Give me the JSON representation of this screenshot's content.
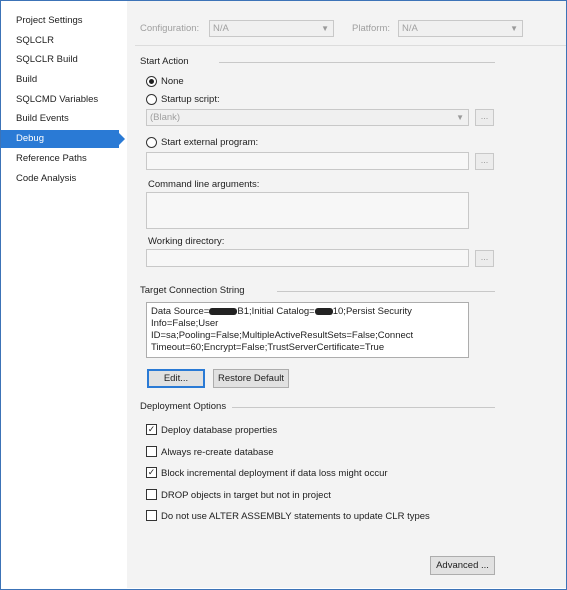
{
  "sidebar": {
    "items": [
      {
        "label": "Project Settings"
      },
      {
        "label": "SQLCLR"
      },
      {
        "label": "SQLCLR Build"
      },
      {
        "label": "Build"
      },
      {
        "label": "SQLCMD Variables"
      },
      {
        "label": "Build Events"
      },
      {
        "label": "Debug",
        "selected": true
      },
      {
        "label": "Reference Paths"
      },
      {
        "label": "Code Analysis"
      }
    ]
  },
  "config_bar": {
    "configuration_label": "Configuration:",
    "configuration_value": "N/A",
    "platform_label": "Platform:",
    "platform_value": "N/A"
  },
  "start_action": {
    "title": "Start Action",
    "none_label": "None",
    "startup_script_label": "Startup script:",
    "startup_script_value": "(Blank)",
    "external_program_label": "Start external program:",
    "browse_label": "...",
    "command_line_label": "Command line arguments:",
    "working_dir_label": "Working directory:"
  },
  "target_connection": {
    "title": "Target Connection String",
    "text_part1": "Data Source=",
    "text_part2": "B1;Initial Catalog=",
    "text_part3": "10;Persist Security Info=False;User ID=sa;Pooling=False;MultipleActiveResultSets=False;Connect Timeout=60;Encrypt=False;TrustServerCertificate=True",
    "edit_button": "Edit...",
    "restore_button": "Restore Default"
  },
  "deployment": {
    "title": "Deployment Options",
    "options": [
      {
        "label": "Deploy database properties",
        "checked": true
      },
      {
        "label": "Always re-create database",
        "checked": false
      },
      {
        "label": "Block incremental deployment if data loss might occur",
        "checked": true
      },
      {
        "label": "DROP objects in target but not in project",
        "checked": false
      },
      {
        "label": "Do not use ALTER ASSEMBLY statements to update CLR types",
        "checked": false
      }
    ],
    "advanced_button": "Advanced ..."
  },
  "colors": {
    "accent": "#2a7ad5",
    "panel_bg": "#f3f3f3",
    "sidebar_bg": "#ffffff"
  }
}
